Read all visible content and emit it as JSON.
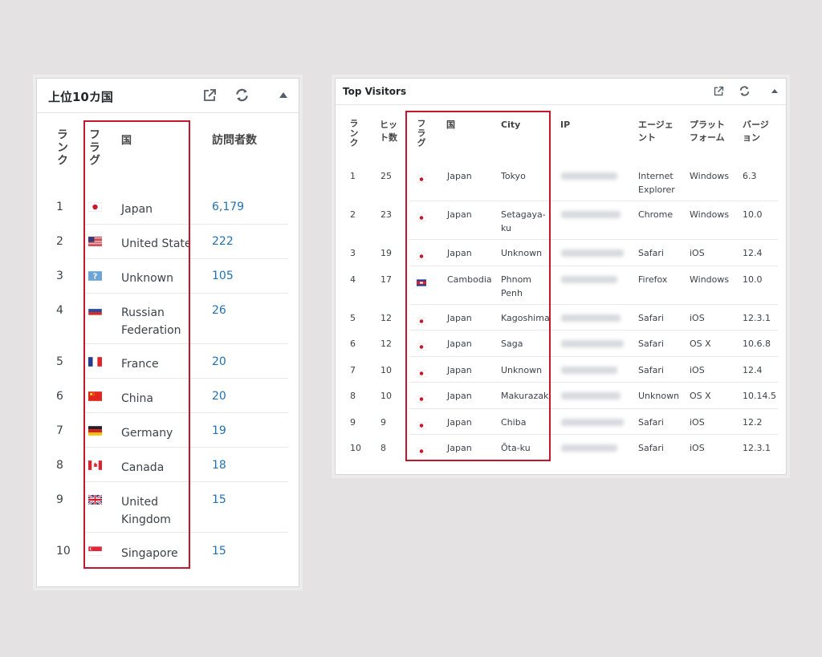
{
  "left_widget": {
    "title": "上位10カ国",
    "headers": {
      "rank": "ランク",
      "flag": "フラグ",
      "country": "国",
      "visitors": "訪問者数"
    },
    "rows": [
      {
        "rank": "1",
        "country": "Japan",
        "visitors": "6,179",
        "flag": "jp"
      },
      {
        "rank": "2",
        "country": "United States",
        "visitors": "222",
        "flag": "us"
      },
      {
        "rank": "3",
        "country": "Unknown",
        "visitors": "105",
        "flag": "unknown"
      },
      {
        "rank": "4",
        "country": "Russian Federation",
        "visitors": "26",
        "flag": "ru"
      },
      {
        "rank": "5",
        "country": "France",
        "visitors": "20",
        "flag": "fr"
      },
      {
        "rank": "6",
        "country": "China",
        "visitors": "20",
        "flag": "cn"
      },
      {
        "rank": "7",
        "country": "Germany",
        "visitors": "19",
        "flag": "de"
      },
      {
        "rank": "8",
        "country": "Canada",
        "visitors": "18",
        "flag": "ca"
      },
      {
        "rank": "9",
        "country": "United Kingdom",
        "visitors": "15",
        "flag": "gb"
      },
      {
        "rank": "10",
        "country": "Singapore",
        "visitors": "15",
        "flag": "sg"
      }
    ]
  },
  "right_widget": {
    "title": "Top Visitors",
    "headers": {
      "rank": "ランク",
      "hits": "ヒット数",
      "flag": "フラグ",
      "country": "国",
      "city": "City",
      "ip": "IP",
      "agent": "エージェント",
      "platform": "プラットフォーム",
      "version": "バージョン"
    },
    "rows": [
      {
        "rank": "1",
        "hits": "25",
        "flag": "jp",
        "country": "Japan",
        "city": "Tokyo",
        "agent": "Internet Explorer",
        "platform": "Windows",
        "version": "6.3"
      },
      {
        "rank": "2",
        "hits": "23",
        "flag": "jp",
        "country": "Japan",
        "city": "Setagaya-ku",
        "agent": "Chrome",
        "platform": "Windows",
        "version": "10.0"
      },
      {
        "rank": "3",
        "hits": "19",
        "flag": "jp",
        "country": "Japan",
        "city": "Unknown",
        "agent": "Safari",
        "platform": "iOS",
        "version": "12.4"
      },
      {
        "rank": "4",
        "hits": "17",
        "flag": "kh",
        "country": "Cambodia",
        "city": "Phnom Penh",
        "agent": "Firefox",
        "platform": "Windows",
        "version": "10.0"
      },
      {
        "rank": "5",
        "hits": "12",
        "flag": "jp",
        "country": "Japan",
        "city": "Kagoshima",
        "agent": "Safari",
        "platform": "iOS",
        "version": "12.3.1"
      },
      {
        "rank": "6",
        "hits": "12",
        "flag": "jp",
        "country": "Japan",
        "city": "Saga",
        "agent": "Safari",
        "platform": "OS X",
        "version": "10.6.8"
      },
      {
        "rank": "7",
        "hits": "10",
        "flag": "jp",
        "country": "Japan",
        "city": "Unknown",
        "agent": "Safari",
        "platform": "iOS",
        "version": "12.4"
      },
      {
        "rank": "8",
        "hits": "10",
        "flag": "jp",
        "country": "Japan",
        "city": "Makurazaki",
        "agent": "Unknown",
        "platform": "OS X",
        "version": "10.14.5"
      },
      {
        "rank": "9",
        "hits": "9",
        "flag": "jp",
        "country": "Japan",
        "city": "Chiba",
        "agent": "Safari",
        "platform": "iOS",
        "version": "12.2"
      },
      {
        "rank": "10",
        "hits": "8",
        "flag": "jp",
        "country": "Japan",
        "city": "Ōta-ku",
        "agent": "Safari",
        "platform": "iOS",
        "version": "12.3.1"
      }
    ]
  },
  "icons": {
    "open": "external-link-icon",
    "refresh": "refresh-icon",
    "collapse": "collapse-triangle-icon"
  },
  "colors": {
    "link": "#2271b1",
    "highlight_box": "#c4172b"
  }
}
